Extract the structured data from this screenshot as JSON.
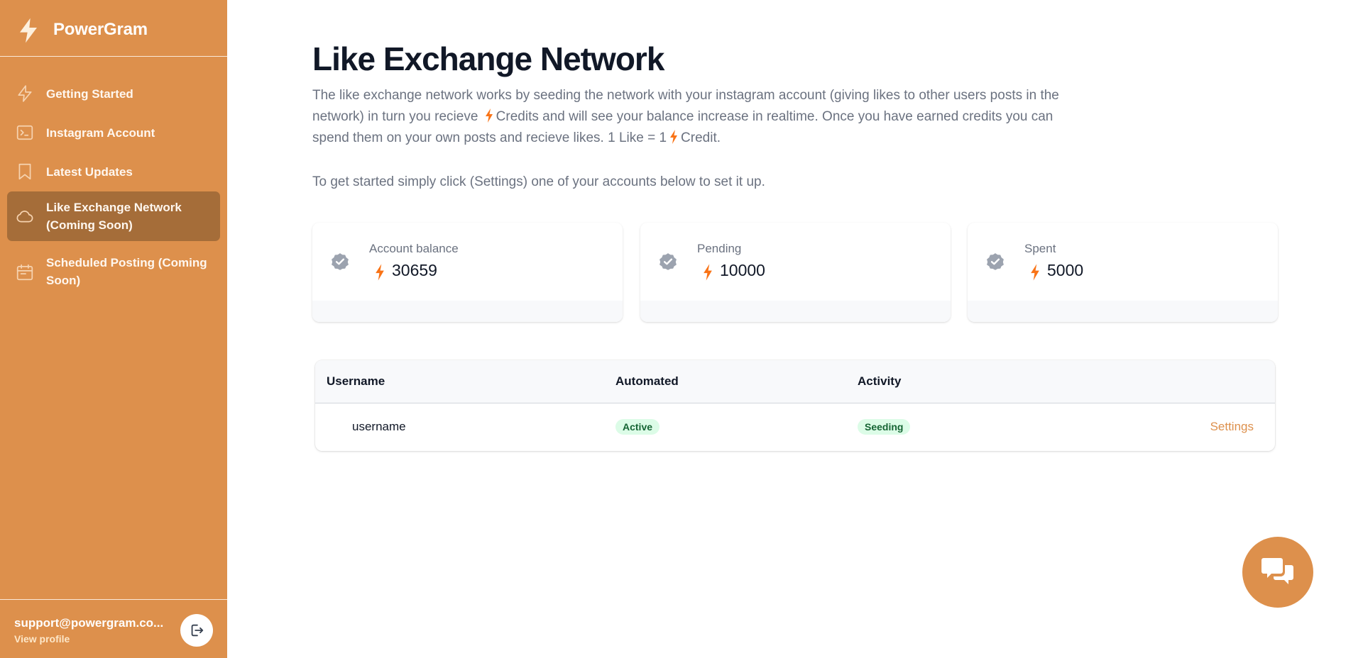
{
  "app": {
    "name": "PowerGram",
    "brand_color": "#dd904c",
    "active_color": "#a56d39",
    "credit_color": "#f97316"
  },
  "sidebar": {
    "items": [
      {
        "label": "Getting Started",
        "icon": "bolt-icon",
        "active": false
      },
      {
        "label": "Instagram Account",
        "icon": "terminal-icon",
        "active": false
      },
      {
        "label": "Latest Updates",
        "icon": "bookmark-icon",
        "active": false
      },
      {
        "label": "Like Exchange Network (Coming Soon)",
        "icon": "cloud-icon",
        "active": true
      },
      {
        "label": "Scheduled Posting (Coming Soon)",
        "icon": "calendar-icon",
        "active": false
      }
    ],
    "footer": {
      "email": "support@powergram.co...",
      "view_profile": "View profile",
      "logout_icon": "logout-icon"
    }
  },
  "main": {
    "title": "Like Exchange Network",
    "intro": {
      "part1": "The like exchange network works by seeding the network with your instagram account (giving likes to other users posts in the network) in turn you recieve ",
      "part2": "Credits and will see your balance increase in realtime. Once you have earned credits you can spend them on your own posts and recieve likes. 1 Like = 1",
      "part3": "Credit."
    },
    "hint": "To get started simply click (Settings) one of your accounts below to set it up.",
    "stats": [
      {
        "label": "Account balance",
        "value": "30659",
        "icon": "badge-check-icon"
      },
      {
        "label": "Pending",
        "value": "10000",
        "icon": "badge-check-icon"
      },
      {
        "label": "Spent",
        "value": "5000",
        "icon": "badge-check-icon"
      }
    ],
    "table": {
      "columns": [
        "Username",
        "Automated",
        "Activity"
      ],
      "rows": [
        {
          "username": "username",
          "automated": "Active",
          "activity": "Seeding",
          "action": "Settings"
        }
      ]
    }
  },
  "chat": {
    "icon": "chat-bubbles-icon"
  }
}
